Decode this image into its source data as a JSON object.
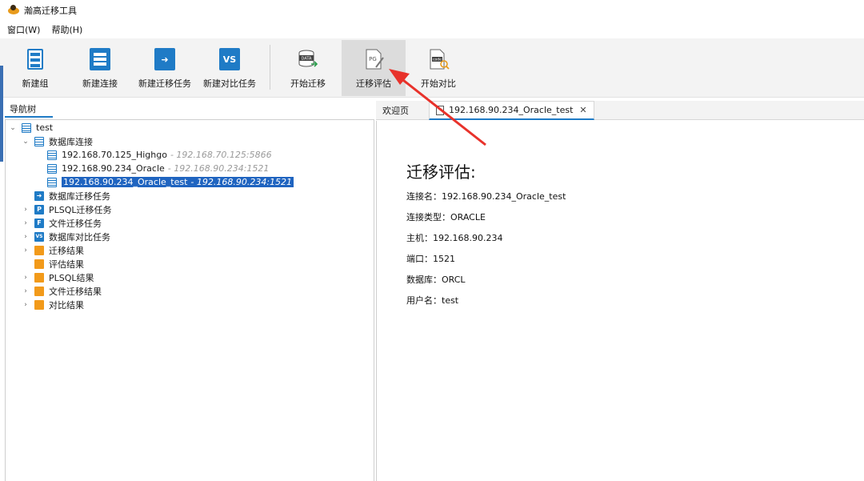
{
  "window": {
    "title": "瀚高迁移工具"
  },
  "menu": [
    {
      "label": "窗口(W)"
    },
    {
      "label": "帮助(H)"
    }
  ],
  "toolbar": {
    "new_group": "新建组",
    "new_connection": "新建连接",
    "new_migration_task": "新建迁移任务",
    "new_compare_task": "新建对比任务",
    "start_migration": "开始迁移",
    "migration_assessment": "迁移评估",
    "start_compare": "开始对比",
    "vs_glyph": "VS",
    "pg_glyph": "PG",
    "data_glyph": "DATA",
    "code_glyph": "code"
  },
  "nav": {
    "tab_label": "导航树",
    "root": "test",
    "db_connections": "数据库连接",
    "connections": [
      {
        "name": "192.168.70.125_Highgo",
        "host": "- 192.168.70.125:5866"
      },
      {
        "name": "192.168.90.234_Oracle",
        "host": "- 192.168.90.234:1521"
      },
      {
        "name": "192.168.90.234_Oracle_test",
        "host": "- 192.168.90.234:1521",
        "selected": true
      }
    ],
    "items": [
      {
        "label": "数据库迁移任务"
      },
      {
        "label": "PLSQL迁移任务",
        "badge": "P"
      },
      {
        "label": "文件迁移任务",
        "badge": "F"
      },
      {
        "label": "数据库对比任务",
        "badge": "VS"
      },
      {
        "label": "迁移结果"
      },
      {
        "label": "评估结果"
      },
      {
        "label": "PLSQL结果"
      },
      {
        "label": "文件迁移结果"
      },
      {
        "label": "对比结果"
      }
    ]
  },
  "editor": {
    "tabs": [
      {
        "label": "欢迎页"
      },
      {
        "label": "192.168.90.234_Oracle_test",
        "close": "✕"
      }
    ]
  },
  "assessment": {
    "title": "迁移评估:",
    "rows": [
      "连接名：192.168.90.234_Oracle_test",
      "连接类型：ORACLE",
      "主机：192.168.90.234",
      "端口：1521",
      "数据库：ORCL",
      "用户名：test"
    ]
  },
  "colors": {
    "accent": "#1f7bc6",
    "selection": "#1f64c0",
    "arrow": "#e8322b",
    "folder": "#f29a1a"
  }
}
